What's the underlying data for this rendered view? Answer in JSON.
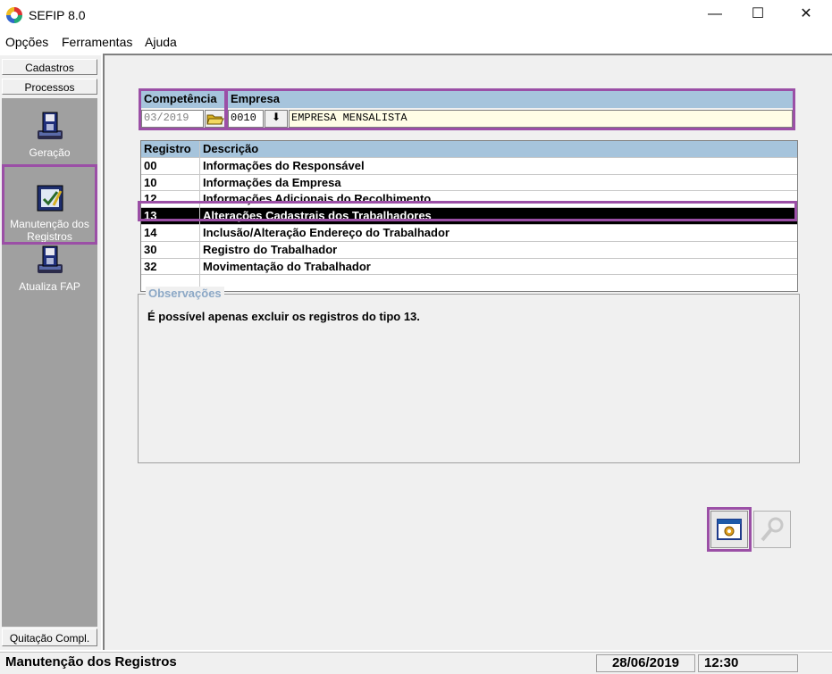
{
  "window": {
    "title": "SEFIP 8.0"
  },
  "menu": [
    "Opções",
    "Ferramentas",
    "Ajuda"
  ],
  "sidebar": {
    "top_buttons": [
      "Cadastros",
      "Processos"
    ],
    "tools": [
      {
        "label": "Geração",
        "icon": "disk-generate-icon"
      },
      {
        "label": "Manutenção dos Registros",
        "icon": "edit-records-icon",
        "selected": true
      },
      {
        "label": "Atualiza FAP",
        "icon": "disk-update-icon"
      }
    ],
    "bottom_button": "Quitação Compl."
  },
  "header": {
    "competencia_label": "Competência",
    "competencia_value": "03/2019",
    "empresa_label": "Empresa",
    "empresa_code": "0010",
    "empresa_name": "EMPRESA MENSALISTA"
  },
  "table": {
    "columns": [
      "Registro",
      "Descrição"
    ],
    "rows": [
      {
        "code": "00",
        "desc": "Informações do Responsável"
      },
      {
        "code": "10",
        "desc": "Informações da Empresa"
      },
      {
        "code": "12",
        "desc": "Informações Adicionais do Recolhimento"
      },
      {
        "code": "13",
        "desc": "Alterações Cadastrais dos Trabalhadores",
        "selected": true
      },
      {
        "code": "14",
        "desc": "Inclusão/Alteração Endereço do Trabalhador"
      },
      {
        "code": "30",
        "desc": "Registro do Trabalhador"
      },
      {
        "code": "32",
        "desc": "Movimentação do Trabalhador"
      }
    ]
  },
  "observacoes": {
    "title": "Observações",
    "text": "É possível  apenas excluir os registros do tipo 13."
  },
  "status": {
    "message": "Manutenção dos Registros",
    "date": "28/06/2019",
    "time": "12:30"
  },
  "colors": {
    "accent_highlight": "#9b4fa6",
    "header_bg": "#a6c4dc",
    "field_bg": "#fffde6"
  }
}
